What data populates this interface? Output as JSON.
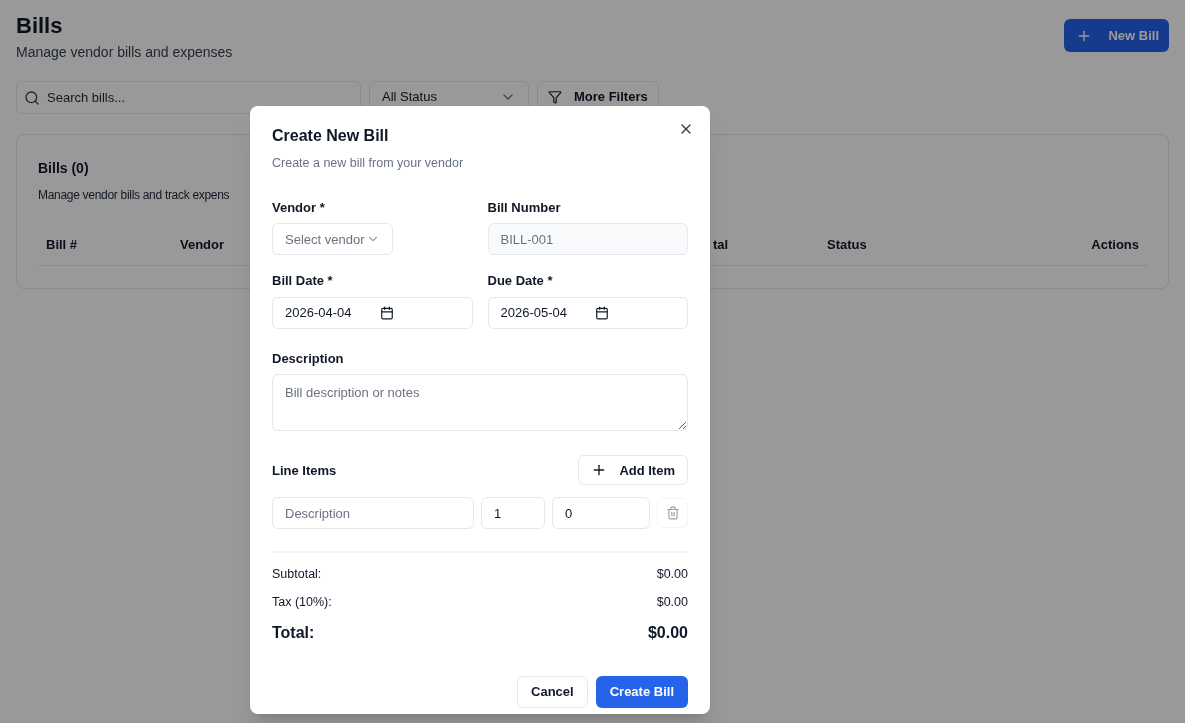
{
  "page": {
    "title": "Bills",
    "subtitle": "Manage vendor bills and expenses",
    "new_button": "New Bill"
  },
  "filters": {
    "search_placeholder": "Search bills...",
    "status": "All Status",
    "more": "More Filters"
  },
  "card": {
    "title": "Bills (0)",
    "subtitle": "Manage vendor bills and track expens",
    "columns": [
      "Bill #",
      "Vendor",
      "tal",
      "Status",
      "Actions"
    ]
  },
  "dialog": {
    "title": "Create New Bill",
    "subtitle": "Create a new bill from your vendor",
    "vendor": {
      "label": "Vendor *",
      "placeholder": "Select vendor"
    },
    "bill_number": {
      "label": "Bill Number",
      "value": "BILL-001",
      "disabled": true
    },
    "bill_date": {
      "label": "Bill Date *",
      "value": "2026-04-04"
    },
    "due_date": {
      "label": "Due Date *",
      "value": "2026-05-04"
    },
    "description": {
      "label": "Description",
      "placeholder": "Bill description or notes"
    },
    "line_items": {
      "label": "Line Items",
      "add": "Add Item",
      "rows": [
        {
          "description_placeholder": "Description",
          "quantity": "1",
          "price": "0"
        }
      ]
    },
    "totals": [
      {
        "label": "Subtotal:",
        "value": "$0.00",
        "grand": false
      },
      {
        "label": "Tax (10%):",
        "value": "$0.00",
        "grand": false
      },
      {
        "label": "Total:",
        "value": "$0.00",
        "grand": true
      }
    ],
    "cancel": "Cancel",
    "submit": "Create Bill"
  }
}
